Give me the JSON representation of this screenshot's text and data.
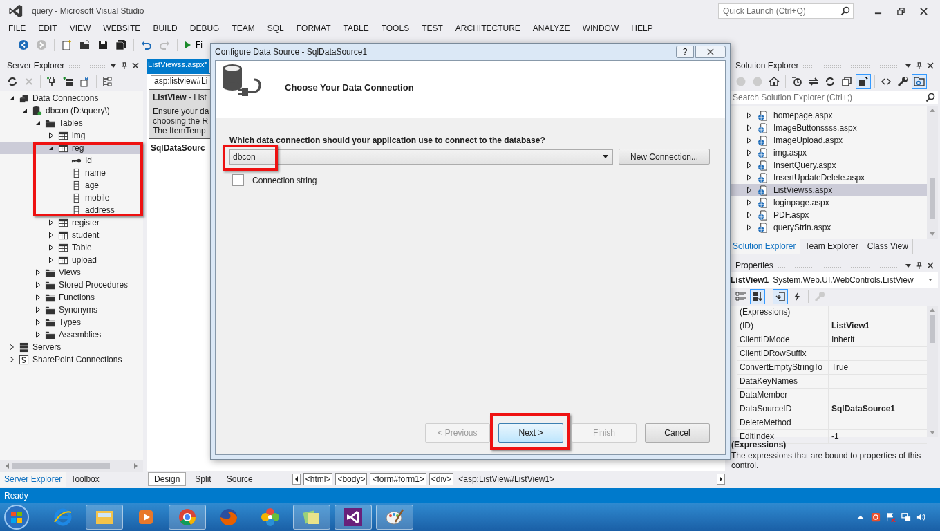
{
  "window": {
    "title": "query - Microsoft Visual Studio",
    "quick_launch": {
      "placeholder": "Quick Launch (Ctrl+Q)"
    }
  },
  "menu": [
    "FILE",
    "EDIT",
    "VIEW",
    "WEBSITE",
    "BUILD",
    "DEBUG",
    "TEAM",
    "SQL",
    "FORMAT",
    "TABLE",
    "TOOLS",
    "TEST",
    "ARCHITECTURE",
    "ANALYZE",
    "WINDOW",
    "HELP"
  ],
  "toolbar": {
    "run_label": "Fi"
  },
  "server_explorer": {
    "title": "Server Explorer",
    "tree": [
      {
        "label": "Data Connections",
        "kind": "connections",
        "expanded": true,
        "selected": false,
        "children": [
          {
            "label": "dbcon (D:\\query\\)",
            "kind": "database",
            "expanded": true,
            "selected": false,
            "children": [
              {
                "label": "Tables",
                "kind": "folder",
                "expanded": true,
                "selected": false,
                "children": [
                  {
                    "label": "img",
                    "kind": "table",
                    "expanded": false,
                    "selected": false
                  },
                  {
                    "label": "reg",
                    "kind": "table",
                    "expanded": true,
                    "selected": true,
                    "highlighted": true,
                    "children": [
                      {
                        "label": "Id",
                        "kind": "key",
                        "selected": false
                      },
                      {
                        "label": "name",
                        "kind": "column",
                        "selected": false
                      },
                      {
                        "label": "age",
                        "kind": "column",
                        "selected": false
                      },
                      {
                        "label": "mobile",
                        "kind": "column",
                        "selected": false
                      },
                      {
                        "label": "address",
                        "kind": "column",
                        "selected": false
                      }
                    ]
                  },
                  {
                    "label": "register",
                    "kind": "table",
                    "expanded": false,
                    "selected": false
                  },
                  {
                    "label": "student",
                    "kind": "table",
                    "expanded": false,
                    "selected": false
                  },
                  {
                    "label": "Table",
                    "kind": "table",
                    "expanded": false,
                    "selected": false
                  },
                  {
                    "label": "upload",
                    "kind": "table",
                    "expanded": false,
                    "selected": false
                  }
                ]
              },
              {
                "label": "Views",
                "kind": "folder",
                "expanded": false,
                "selected": false
              },
              {
                "label": "Stored Procedures",
                "kind": "folder",
                "expanded": false,
                "selected": false
              },
              {
                "label": "Functions",
                "kind": "folder",
                "expanded": false,
                "selected": false
              },
              {
                "label": "Synonyms",
                "kind": "folder",
                "expanded": false,
                "selected": false
              },
              {
                "label": "Types",
                "kind": "folder",
                "expanded": false,
                "selected": false
              },
              {
                "label": "Assemblies",
                "kind": "folder",
                "expanded": false,
                "selected": false
              }
            ]
          }
        ]
      },
      {
        "label": "Servers",
        "kind": "servers",
        "expanded": false,
        "selected": false
      },
      {
        "label": "SharePoint Connections",
        "kind": "sharepoint",
        "expanded": false,
        "selected": false
      }
    ],
    "tabs": [
      {
        "label": "Server Explorer",
        "selected": true
      },
      {
        "label": "Toolbox",
        "selected": false
      }
    ]
  },
  "editor": {
    "tab": {
      "label": "ListViewss.aspx*",
      "selected": true
    },
    "tag_label": "asp:listview#Li",
    "smart_tag": {
      "title": "**ListView** - List",
      "lines": [
        "Ensure your da",
        "choosing the R",
        "The ItemTemp"
      ]
    },
    "control_label": "SqlDataSourc",
    "views": [
      {
        "label": "Design",
        "selected": true
      },
      {
        "label": "Split",
        "selected": false
      },
      {
        "label": "Source",
        "selected": false
      }
    ],
    "breadcrumbs": [
      {
        "label": "<html>",
        "current": false
      },
      {
        "label": "<body>",
        "current": false
      },
      {
        "label": "<form#form1>",
        "current": false
      },
      {
        "label": "<div>",
        "current": false
      },
      {
        "label": "<asp:ListView#ListView1>",
        "current": true
      }
    ]
  },
  "dialog": {
    "title": "Configure Data Source - SqlDataSource1",
    "help_label": "?",
    "heading": "Choose Your Data Connection",
    "question": "Which data connection should your application use to connect to the database?",
    "connection": {
      "value": "dbcon",
      "highlighted": true
    },
    "new_connection": "New Connection...",
    "connection_string": {
      "label": "Connection string",
      "expanded": false,
      "toggle": "+"
    },
    "buttons": [
      {
        "label": "< Previous",
        "disabled": true,
        "highlighted": false,
        "default": false
      },
      {
        "label": "Next >",
        "disabled": false,
        "highlighted": true,
        "default": true
      },
      {
        "label": "Finish",
        "disabled": true,
        "highlighted": false,
        "default": false
      },
      {
        "label": "Cancel",
        "disabled": false,
        "highlighted": false,
        "default": false
      }
    ]
  },
  "solution_explorer": {
    "title": "Solution Explorer",
    "search": {
      "placeholder": "Search Solution Explorer (Ctrl+;)"
    },
    "files": [
      {
        "label": "homepage.aspx",
        "selected": false
      },
      {
        "label": "ImageButtonssss.aspx",
        "selected": false
      },
      {
        "label": "ImageUpload.aspx",
        "selected": false
      },
      {
        "label": "img.aspx",
        "selected": false
      },
      {
        "label": "InsertQuery.aspx",
        "selected": false
      },
      {
        "label": "InsertUpdateDelete.aspx",
        "selected": false
      },
      {
        "label": "ListViewss.aspx",
        "selected": true
      },
      {
        "label": "loginpage.aspx",
        "selected": false
      },
      {
        "label": "PDF.aspx",
        "selected": false
      },
      {
        "label": "queryStrin.aspx",
        "selected": false
      }
    ],
    "tabs": [
      {
        "label": "Solution Explorer",
        "selected": true
      },
      {
        "label": "Team Explorer",
        "selected": false
      },
      {
        "label": "Class View",
        "selected": false
      }
    ]
  },
  "properties": {
    "title": "Properties",
    "object_name": "ListView1",
    "object_type": "System.Web.UI.WebControls.ListView",
    "rows": [
      {
        "name": "(Expressions)"
      },
      {
        "name": "(ID)",
        "value": "ListView1",
        "modified": true
      },
      {
        "name": "ClientIDMode",
        "value": "Inherit",
        "modified": false
      },
      {
        "name": "ClientIDRowSuffix"
      },
      {
        "name": "ConvertEmptyStringTo",
        "value": "True",
        "modified": false
      },
      {
        "name": "DataKeyNames"
      },
      {
        "name": "DataMember"
      },
      {
        "name": "DataSourceID",
        "value": "SqlDataSource1",
        "modified": true
      },
      {
        "name": "DeleteMethod"
      },
      {
        "name": "EditIndex",
        "value": "-1",
        "modified": false
      }
    ],
    "description": {
      "title": "(Expressions)",
      "text": "The expressions that are bound to properties of this control."
    }
  },
  "status_bar": {
    "text": "Ready"
  },
  "taskbar": [
    {
      "kind": "ie",
      "running": false
    },
    {
      "kind": "explorer",
      "running": true
    },
    {
      "kind": "media",
      "running": false
    },
    {
      "kind": "chrome",
      "running": true
    },
    {
      "kind": "firefox",
      "running": false
    },
    {
      "kind": "pinwheel",
      "running": false
    },
    {
      "kind": "notes",
      "running": true
    },
    {
      "kind": "vs",
      "running": true
    },
    {
      "kind": "paint",
      "running": true
    }
  ]
}
